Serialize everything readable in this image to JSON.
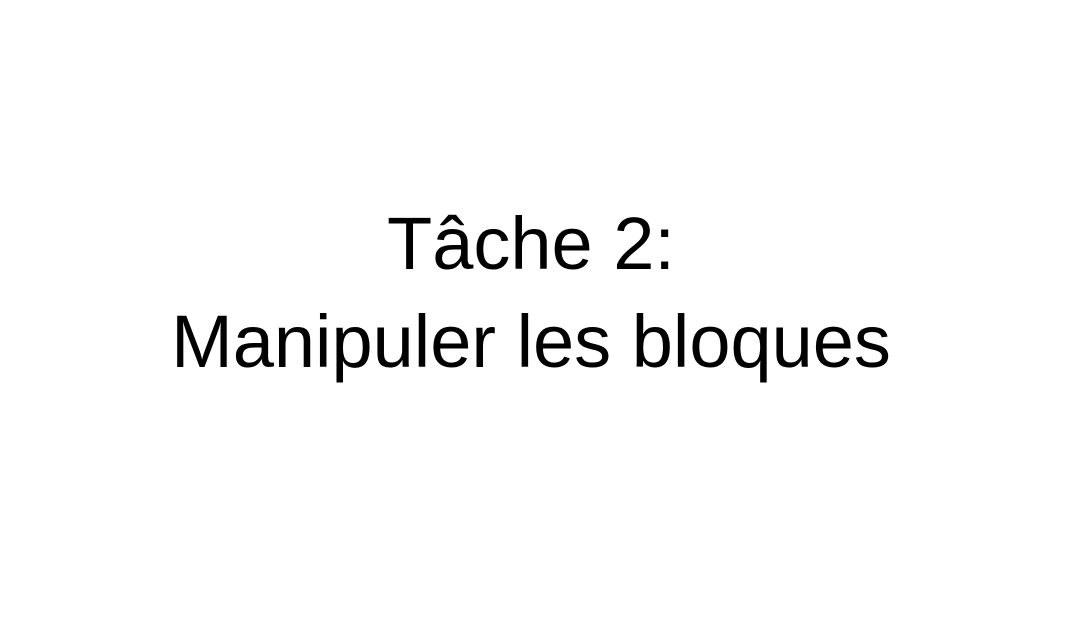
{
  "slide": {
    "title_line_1": "Tâche 2:",
    "title_line_2": "Manipuler les bloques"
  },
  "colors": {
    "background": "#ffffff",
    "text": "#000000"
  }
}
